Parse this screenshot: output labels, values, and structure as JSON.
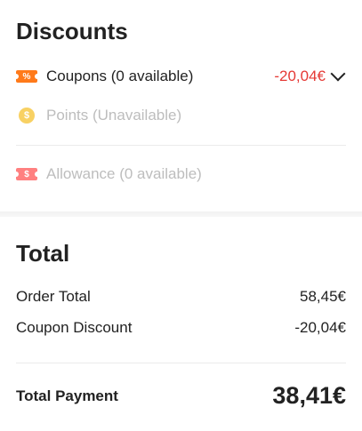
{
  "discounts": {
    "title": "Discounts",
    "coupons": {
      "icon": "coupon-ticket-icon",
      "icon_glyph": "%",
      "label": "Coupons (0 available)",
      "value": "-20,04€",
      "value_color": "#e53935"
    },
    "points": {
      "icon": "points-coin-icon",
      "icon_glyph": "$",
      "label": "Points (Unavailable)"
    },
    "allowance": {
      "icon": "allowance-ticket-icon",
      "icon_glyph": "$",
      "label": "Allowance (0 available)"
    }
  },
  "total": {
    "title": "Total",
    "order_total_label": "Order Total",
    "order_total_value": "58,45€",
    "coupon_discount_label": "Coupon Discount",
    "coupon_discount_value": "-20,04€",
    "total_payment_label": "Total Payment",
    "total_payment_value": "38,41€"
  },
  "colors": {
    "accent_red": "#e53935",
    "coupon_orange": "#ff7a1a",
    "points_gold": "#f7c948",
    "allowance_red": "#ff6b6b",
    "disabled_text": "#bdbdbd"
  }
}
